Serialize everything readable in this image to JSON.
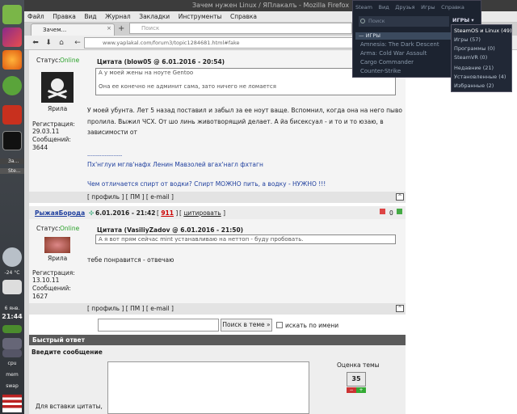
{
  "panel": {
    "weather_temp": "-24 °C",
    "date": "6 янв.",
    "time": "21:44",
    "cpu_label": "cpu",
    "mem_label": "mem",
    "swap_label": "swap",
    "tasks": [
      "За...",
      "Ste..."
    ]
  },
  "window": {
    "title": "Зачем нужен Linux / ЯПлакалъ - Mozilla Firefox"
  },
  "menu": [
    "Файл",
    "Правка",
    "Вид",
    "Журнал",
    "Закладки",
    "Инструменты",
    "Справка"
  ],
  "tab": {
    "label": "Зачем...",
    "close": "×",
    "new": "+"
  },
  "search": {
    "placeholder": "Поиск"
  },
  "nav": {
    "url": "www.yaplakal.com/forum3/topic1284681.html#fake"
  },
  "post1": {
    "status_label": "Статус:",
    "status": "Online",
    "user_rank": "Ярила",
    "reg_label": "Регистрация:",
    "reg_date": "29.03.11",
    "msgs_label": "Сообщений:",
    "msgs": "3644",
    "quote_head": "Цитата (blow05 @ 6.01.2016 - 20:54)",
    "quote1": "А у моей жены на ноуте Gentoo",
    "quote2": "Она ее конечно не админит сама, зато ничего не ломается",
    "text1": "У моей убунта. Лет 5 назад поставил и забыл за ее ноут ваще. Вспомнил, когда она на него пыво",
    "text2": "пролила. Выжил ЧСХ. От шо линь животворящий делает. А йа бисексуал - и то и то юзаю, в",
    "text3": "зависимости от",
    "sep": "--------------------",
    "sig1": "Пх'нглуи мглв'нафх Ленин Мавзолей вгах'нагл фхтагн",
    "sig2": "Чем отличается спирт от водки? Спирт МОЖНО пить, а водку - НУЖНО !!!",
    "links": [
      "[ профиль ]",
      "[ ПМ ]",
      "[ e-mail ]"
    ],
    "up": "^"
  },
  "post2": {
    "author": "РыжаяБорода",
    "date": "6.01.2016 - 21:42",
    "num": "911",
    "cite": "цитировать",
    "rating": "0",
    "status_label": "Статус:",
    "status": "Online",
    "user_rank": "Ярила",
    "reg_label": "Регистрация:",
    "reg_date": "13.10.11",
    "msgs_label": "Сообщений:",
    "msgs": "1627",
    "quote_head": "Цитата (VasiliyZadov @ 6.01.2016 - 21:50)",
    "quote1": "А я вот прям сейчас mint устанавливаю на неттоп - буду пробовать.",
    "text1": "тебе понравится - отвечаю",
    "links": [
      "[ профиль ]",
      "[ ПМ ]",
      "[ e-mail ]"
    ],
    "up": "^"
  },
  "search_topic": {
    "button": "Поиск в теме »",
    "checkbox_label": "искать по имени"
  },
  "quick_reply": {
    "title": "Быстрый ответ",
    "enter_msg": "Введите сообщение",
    "rating_label": "Оценка темы",
    "rating_value": "35",
    "hint": "Для вставки цитаты,"
  },
  "steam": {
    "menu": [
      "Steam",
      "Вид",
      "Друзья",
      "Игры",
      "Справка"
    ],
    "search_placeholder": "Поиск",
    "games_btn": "ИГРЫ ▾",
    "games_header": "— ИГРЫ",
    "games": [
      "Amnesia: The Dark Descent",
      "Arma: Cold War Assault",
      "Cargo Commander",
      "Counter-Strike"
    ],
    "dropdown": [
      "SteamOS и Linux (49)",
      "Игры (57)",
      "Программы (0)",
      "SteamVR (0)",
      "Недавние (21)",
      "Установленные (4)",
      "Избранные (2)"
    ]
  },
  "colors": {
    "steam_bg": "#1c2330",
    "online": "#28a028",
    "link": "#1f3f9e"
  }
}
